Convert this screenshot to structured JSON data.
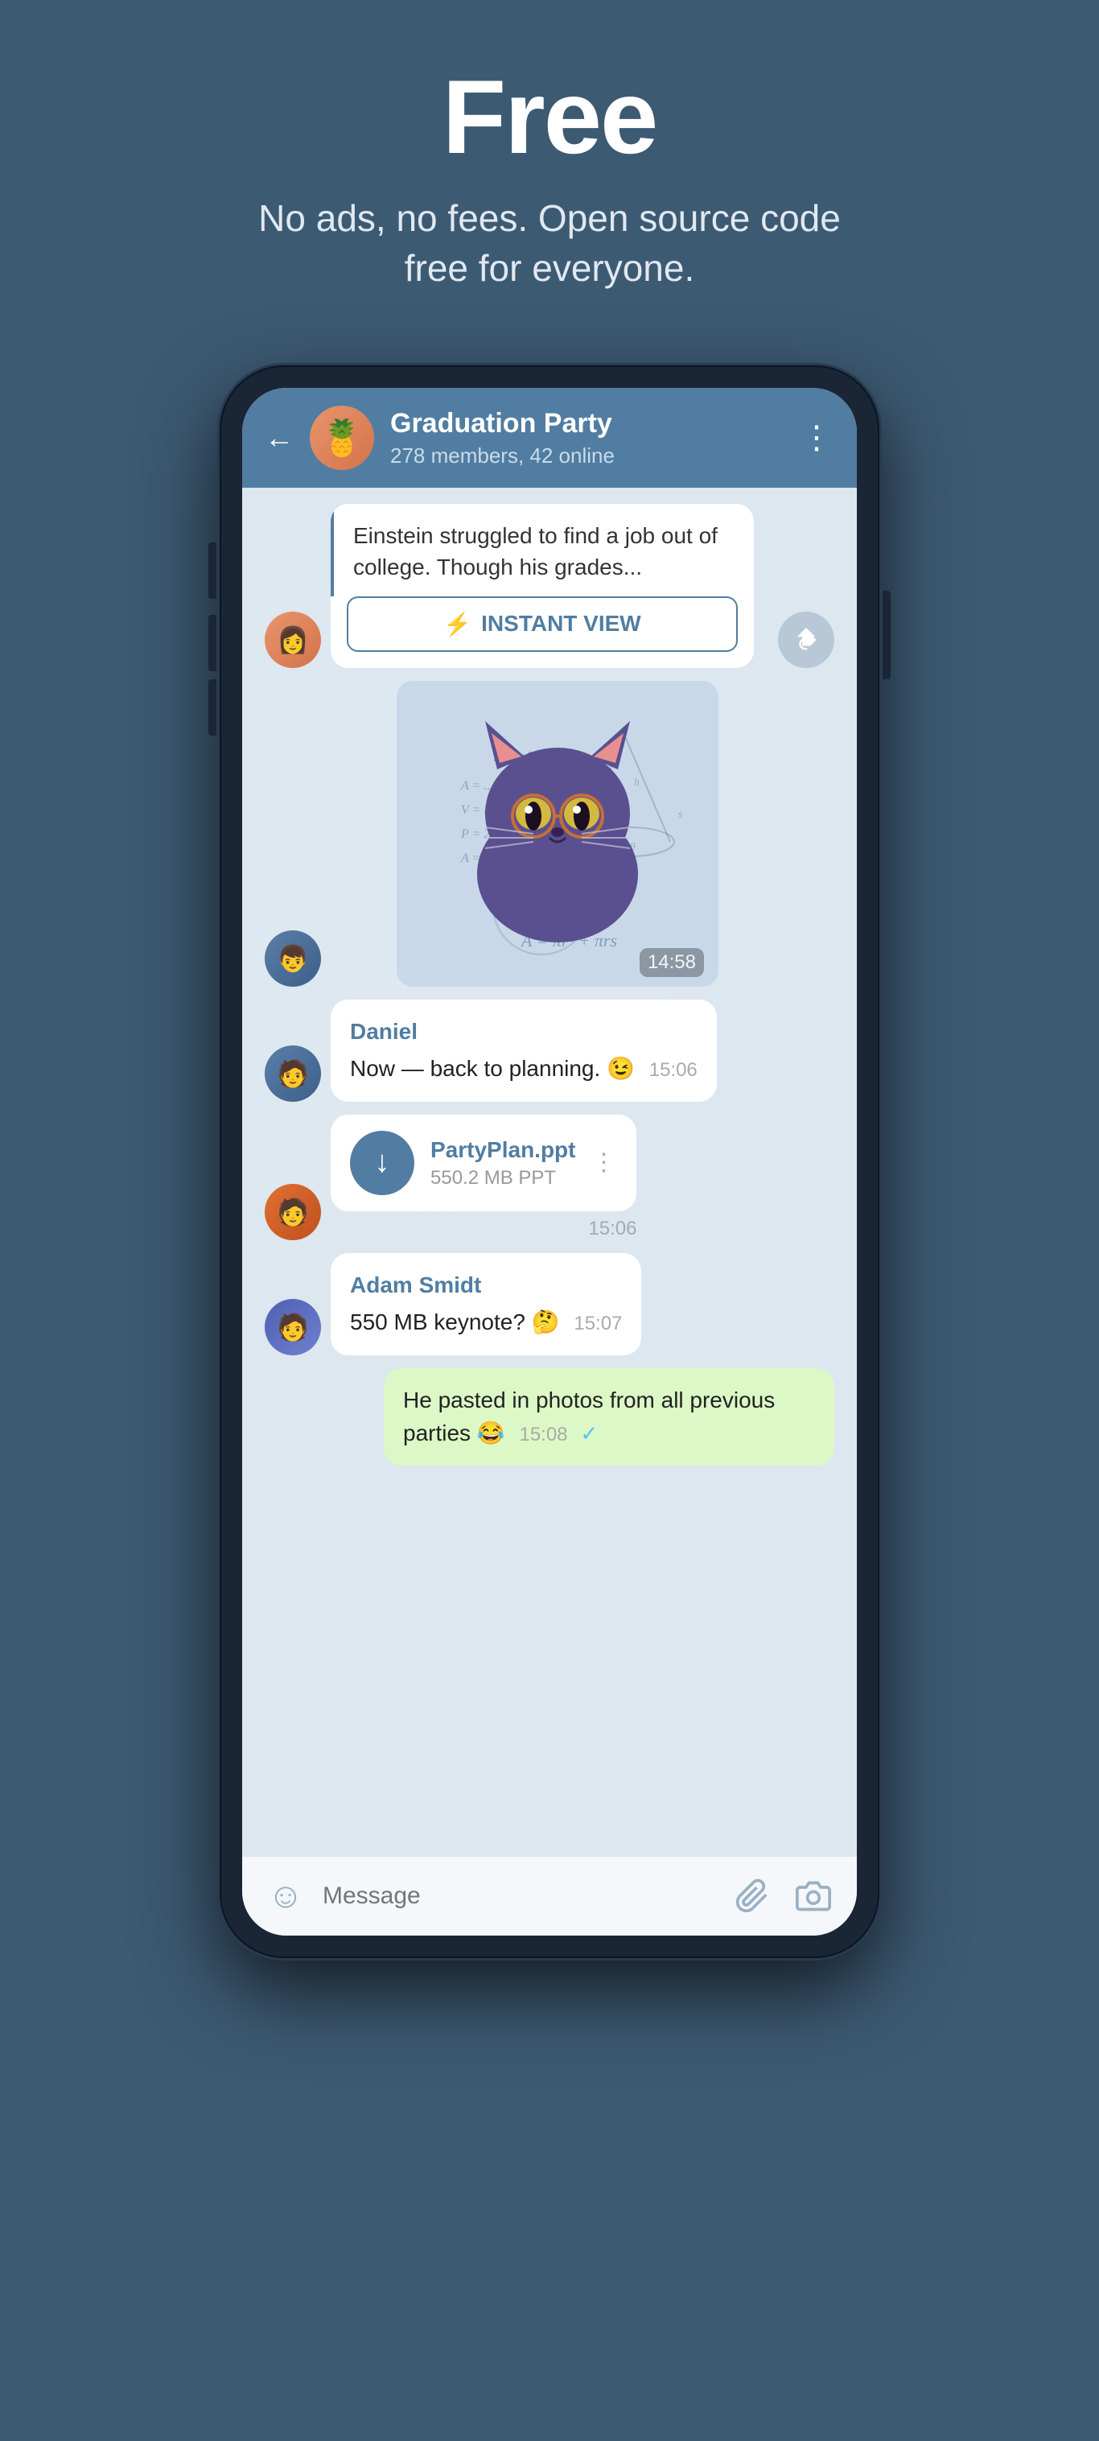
{
  "hero": {
    "title": "Free",
    "subtitle": "No ads, no fees. Open source code free for everyone."
  },
  "chat": {
    "name": "Graduation Party",
    "meta": "278 members, 42 online",
    "back_label": "←",
    "more_label": "⋮"
  },
  "messages": [
    {
      "id": "article-msg",
      "type": "article",
      "text": "Einstein struggled to find a job out of college. Though his grades...",
      "instant_view_label": "INSTANT VIEW"
    },
    {
      "id": "sticker-msg",
      "type": "sticker",
      "time": "14:58"
    },
    {
      "id": "daniel-msg",
      "type": "text",
      "sender": "Daniel",
      "text": "Now — back to planning. 😉",
      "time": "15:06"
    },
    {
      "id": "file-msg",
      "type": "file",
      "file_name": "PartyPlan.ppt",
      "file_size": "550.2 MB PPT",
      "time": "15:06"
    },
    {
      "id": "adam-msg",
      "type": "text",
      "sender": "Adam Smidt",
      "text": "550 MB keynote? 🤔",
      "time": "15:07"
    },
    {
      "id": "self-msg",
      "type": "text-self",
      "text": "He pasted in photos from all previous parties 😂",
      "time": "15:08"
    }
  ],
  "input_bar": {
    "placeholder": "Message"
  },
  "icons": {
    "back": "←",
    "more": "⋮",
    "lightning": "⚡",
    "forward": "↩",
    "download": "↓",
    "emoji": "☺",
    "attach": "🖇",
    "camera": "⊙",
    "tick": "✓"
  }
}
